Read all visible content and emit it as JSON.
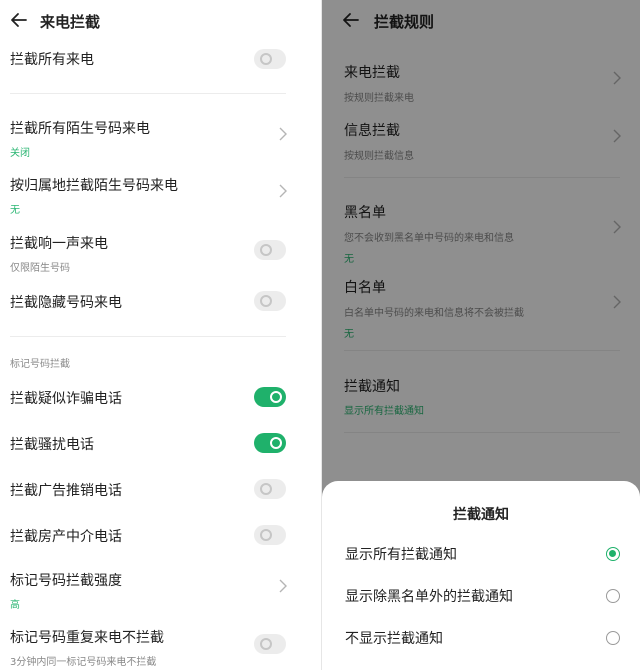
{
  "left": {
    "title": "来电拦截",
    "section_label": "标记号码拦截",
    "rows": [
      {
        "title": "拦截所有来电",
        "sub": "",
        "control": "switch",
        "on": false
      },
      {
        "title": "拦截所有陌生号码来电",
        "sub": "关闭",
        "control": "chevron"
      },
      {
        "title": "按归属地拦截陌生号码来电",
        "sub": "无",
        "control": "chevron"
      },
      {
        "title": "拦截响一声来电",
        "sub": "仅限陌生号码",
        "control": "switch",
        "on": false
      },
      {
        "title": "拦截隐藏号码来电",
        "sub": "",
        "control": "switch",
        "on": false
      },
      {
        "title": "拦截疑似诈骗电话",
        "sub": "",
        "control": "switch",
        "on": true
      },
      {
        "title": "拦截骚扰电话",
        "sub": "",
        "control": "switch",
        "on": true
      },
      {
        "title": "拦截广告推销电话",
        "sub": "",
        "control": "switch",
        "on": false
      },
      {
        "title": "拦截房产中介电话",
        "sub": "",
        "control": "switch",
        "on": false
      },
      {
        "title": "标记号码拦截强度",
        "sub": "高",
        "control": "chevron"
      },
      {
        "title": "标记号码重复来电不拦截",
        "sub": "3分钟内同一标记号码来电不拦截",
        "control": "switch",
        "on": false
      }
    ]
  },
  "right": {
    "title": "拦截规则",
    "rows": [
      {
        "title": "来电拦截",
        "sub": "按规则拦截来电"
      },
      {
        "title": "信息拦截",
        "sub": "按规则拦截信息"
      },
      {
        "title": "黑名单",
        "sub": "您不会收到黑名单中号码的来电和信息",
        "sub2": "无"
      },
      {
        "title": "白名单",
        "sub": "白名单中号码的来电和信息将不会被拦截",
        "sub2": "无"
      },
      {
        "title": "拦截通知",
        "sub2": "显示所有拦截通知"
      }
    ],
    "sheet": {
      "title": "拦截通知",
      "options": [
        {
          "label": "显示所有拦截通知",
          "selected": true
        },
        {
          "label": "显示除黑名单外的拦截通知",
          "selected": false
        },
        {
          "label": "不显示拦截通知",
          "selected": false
        }
      ]
    }
  },
  "colors": {
    "accent": "#1fb16b",
    "green_text": "#2bb673"
  },
  "icons": {
    "back": "arrow-left-icon",
    "chevron": "chevron-right-icon"
  }
}
